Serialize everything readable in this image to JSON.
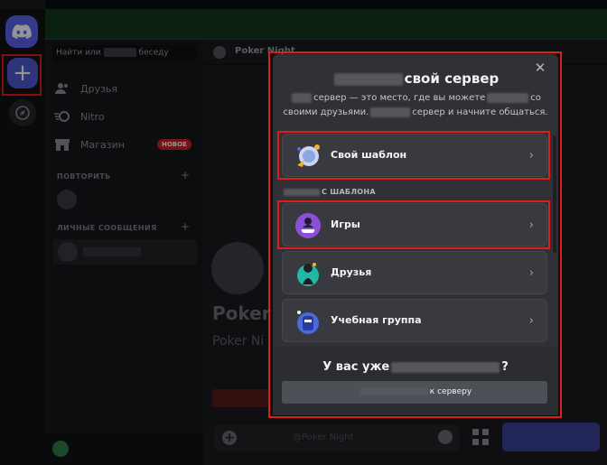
{
  "sidebar": {
    "search_prefix": "Найти или",
    "search_suffix": "беседу",
    "nav": [
      {
        "label": "Друзья",
        "icon": "friends-icon"
      },
      {
        "label": "Nitro",
        "icon": "nitro-icon"
      },
      {
        "label": "Магазин",
        "icon": "shop-icon",
        "badge": "НОВОЕ"
      }
    ],
    "section_repeat": "ПОВТОРИТЬ",
    "section_dms": "ЛИЧНЫЕ СООБЩЕНИЯ",
    "plus": "+"
  },
  "chat": {
    "title": "Poker Night",
    "big_title": "Poker",
    "subtitle": "Poker Ni",
    "message_placeholder": "@Poker Night"
  },
  "modal": {
    "title_visible": "свой сервер",
    "desc_line1_mid": "сервер — это место, где вы можете",
    "desc_line1_end": "со",
    "desc_line2_start": "своими друзьями.",
    "desc_line2_end": "сервер и начните общаться.",
    "close": "✕",
    "own_template": "Свой шаблон",
    "section_suffix": "С ШАБЛОНА",
    "templates": [
      "Игры",
      "Друзья",
      "Учебная группа"
    ],
    "footer_title_start": "У вас уже",
    "footer_title_end": "?",
    "join_button_suffix": "к серверу",
    "chevron": "›"
  },
  "colors": {
    "accent": "#5865f2",
    "highlight_red": "#e21b1b",
    "badge_red": "#c7242d"
  }
}
